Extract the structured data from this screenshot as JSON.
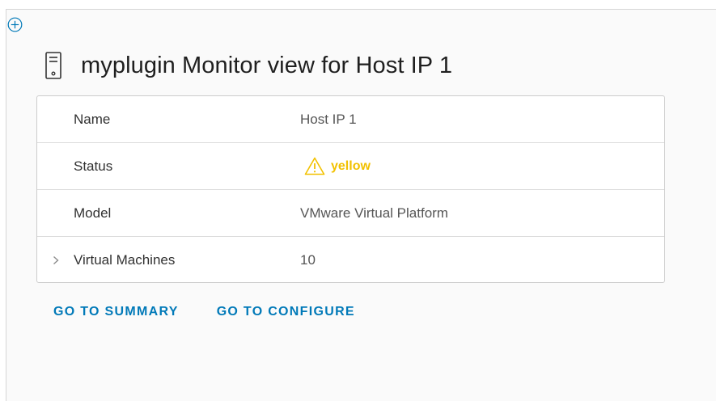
{
  "header": {
    "title": "myplugin Monitor view for Host IP 1",
    "icon": "host-server-icon"
  },
  "toolbar": {
    "add_icon": "circle-plus-icon"
  },
  "properties": [
    {
      "label": "Name",
      "value": "Host IP 1"
    },
    {
      "label": "Status",
      "value": "yellow",
      "icon": "warning-triangle-icon",
      "color": "#f2c100"
    },
    {
      "label": "Model",
      "value": "VMware Virtual Platform"
    },
    {
      "label": "Virtual Machines",
      "value": "10",
      "expandable": true,
      "expander_icon": "chevron-right-icon"
    }
  ],
  "actions": {
    "go_to_summary": "GO TO SUMMARY",
    "go_to_configure": "GO TO CONFIGURE"
  },
  "colors": {
    "accent": "#0079b8",
    "warning": "#f2c100",
    "border": "#cccccc"
  }
}
